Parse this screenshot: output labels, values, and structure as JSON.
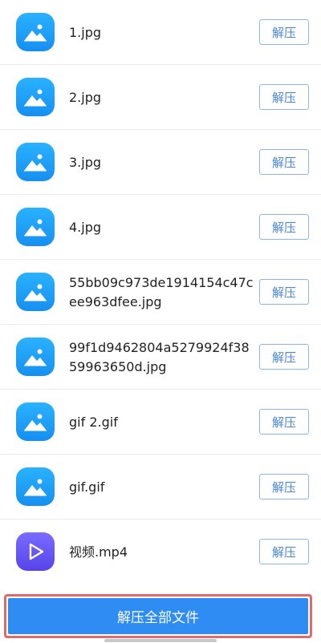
{
  "files": [
    {
      "name": "1.jpg",
      "type": "image",
      "icon": "image-file-icon",
      "action": "解压"
    },
    {
      "name": "2.jpg",
      "type": "image",
      "icon": "image-file-icon",
      "action": "解压"
    },
    {
      "name": "3.jpg",
      "type": "image",
      "icon": "image-file-icon",
      "action": "解压"
    },
    {
      "name": "4.jpg",
      "type": "image",
      "icon": "image-file-icon",
      "action": "解压"
    },
    {
      "name": "55bb09c973de1914154c47cee963dfee.jpg",
      "type": "image",
      "icon": "image-file-icon",
      "action": "解压"
    },
    {
      "name": "99f1d9462804a5279924f3859963650d.jpg",
      "type": "image",
      "icon": "image-file-icon",
      "action": "解压"
    },
    {
      "name": "gif 2.gif",
      "type": "image",
      "icon": "image-file-icon",
      "action": "解压"
    },
    {
      "name": "gif.gif",
      "type": "image",
      "icon": "image-file-icon",
      "action": "解压"
    },
    {
      "name": "视频.mp4",
      "type": "video",
      "icon": "video-file-icon",
      "action": "解压"
    }
  ],
  "bottom_button": {
    "label": "解压全部文件"
  },
  "colors": {
    "image_icon": "#1e9cf8",
    "video_icon": "#6a58f4",
    "button_border": "#8fb6e8",
    "button_text": "#4a86d8",
    "primary": "#2f8cf3",
    "highlight_border": "#e06a6a"
  }
}
